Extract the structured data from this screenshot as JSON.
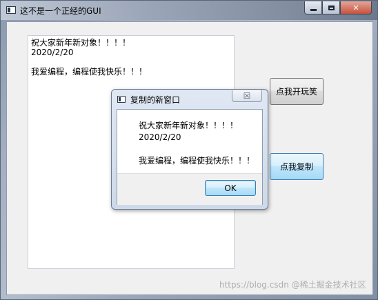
{
  "window": {
    "title": "这不是一个正经的GUI",
    "controls": {
      "minimize": "minimize-icon",
      "maximize": "maximize-icon",
      "close": "✕"
    }
  },
  "textarea": {
    "lines": [
      "祝大家新年新对象！！！！",
      "2020/2/20",
      "",
      "我爱编程，编程使我快乐！！！"
    ]
  },
  "buttons": {
    "joke_label": "点我开玩笑",
    "copy_label": "点我复制"
  },
  "dialog": {
    "title": "复制的新窗口",
    "close_glyph": "☒",
    "message_lines": [
      "祝大家新年新对象！！！！",
      "2020/2/20",
      "",
      "我爱编程，编程使我快乐！！！"
    ],
    "ok_label": "OK"
  },
  "watermark": "https://blog.csdn @稀土掘金技术社区",
  "colors": {
    "accent_border": "#3c7fb1",
    "close_button": "#c9523b",
    "client_bg": "#f0f0f0"
  }
}
